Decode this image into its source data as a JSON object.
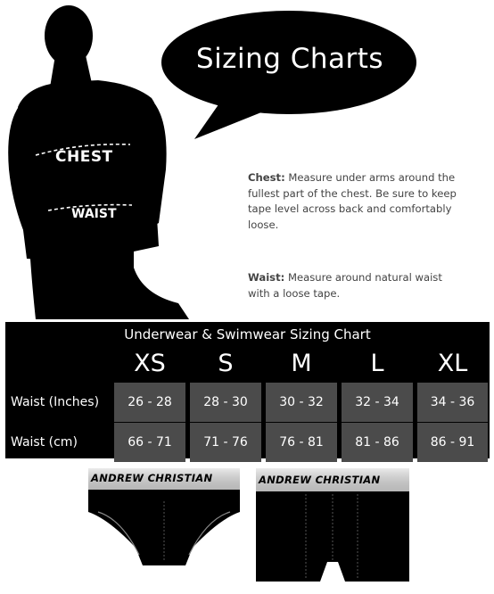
{
  "bubble": {
    "title": "Sizing Charts"
  },
  "figure": {
    "chest_label": "CHEST",
    "waist_label": "WAIST"
  },
  "descriptions": {
    "chest": {
      "term": "Chest:",
      "text": " Measure under arms around the fullest part of the chest. Be sure to keep tape level across back and comfortably loose."
    },
    "waist": {
      "term": "Waist:",
      "text": " Measure around natural waist with a loose tape."
    }
  },
  "table": {
    "title": "Underwear & Swimwear Sizing Chart",
    "sizes": [
      "XS",
      "S",
      "M",
      "L",
      "XL"
    ],
    "rows": [
      {
        "label": "Waist (Inches)",
        "values": [
          "26 - 28",
          "28 - 30",
          "30 - 32",
          "32 - 34",
          "34 - 36"
        ]
      },
      {
        "label": "Waist (cm)",
        "values": [
          "66 - 71",
          "71 - 76",
          "76 - 81",
          "81 - 86",
          "86 - 91"
        ]
      }
    ]
  },
  "products": {
    "brief_brand": "ANDREW CHRISTIAN",
    "trunk_brand": "ANDREW CHRISTIAN"
  },
  "colors": {
    "table_bg": "#000000",
    "cell_bg": "#4b4b4b",
    "band": "#c9c9c9"
  }
}
